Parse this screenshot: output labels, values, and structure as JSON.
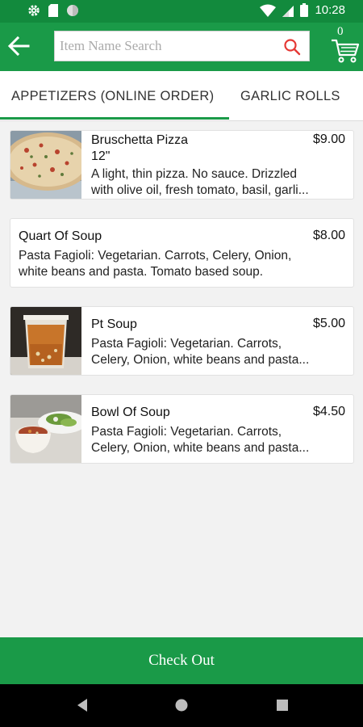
{
  "status_bar": {
    "time": "10:28"
  },
  "search": {
    "placeholder": "Item Name Search",
    "value": ""
  },
  "cart": {
    "count": "0"
  },
  "tabs": [
    {
      "label": "APPETIZERS (ONLINE ORDER)",
      "selected": true
    },
    {
      "label": "GARLIC ROLLS",
      "selected": false
    }
  ],
  "items": [
    {
      "name_line1": "Bruschetta Pizza",
      "name_line2": "12\"",
      "price": "$9.00",
      "desc_line1": "A light, thin pizza. No sauce. Drizzled",
      "desc_line2": "with olive oil, fresh tomato, basil, garli...",
      "image": "pizza-photo"
    },
    {
      "name_line1": "Quart Of Soup",
      "name_line2": "",
      "price": "$8.00",
      "desc_line1": "Pasta Fagioli: Vegetarian. Carrots, Celery, Onion,",
      "desc_line2": "white beans and pasta. Tomato based soup.",
      "image": ""
    },
    {
      "name_line1": "Pt Soup",
      "name_line2": "",
      "price": "$5.00",
      "desc_line1": "Pasta Fagioli: Vegetarian. Carrots,",
      "desc_line2": "Celery, Onion, white beans and pasta...",
      "image": "soup-container-photo"
    },
    {
      "name_line1": "Bowl Of Soup",
      "name_line2": "",
      "price": "$4.50",
      "desc_line1": "Pasta Fagioli: Vegetarian. Carrots,",
      "desc_line2": "Celery, Onion, white beans and pasta...",
      "image": "soup-bowl-photo"
    }
  ],
  "checkout": {
    "label": "Check Out"
  },
  "colors": {
    "primary": "#1a9a48",
    "status_bar": "#128a3d",
    "search_icon": "#e53935"
  }
}
